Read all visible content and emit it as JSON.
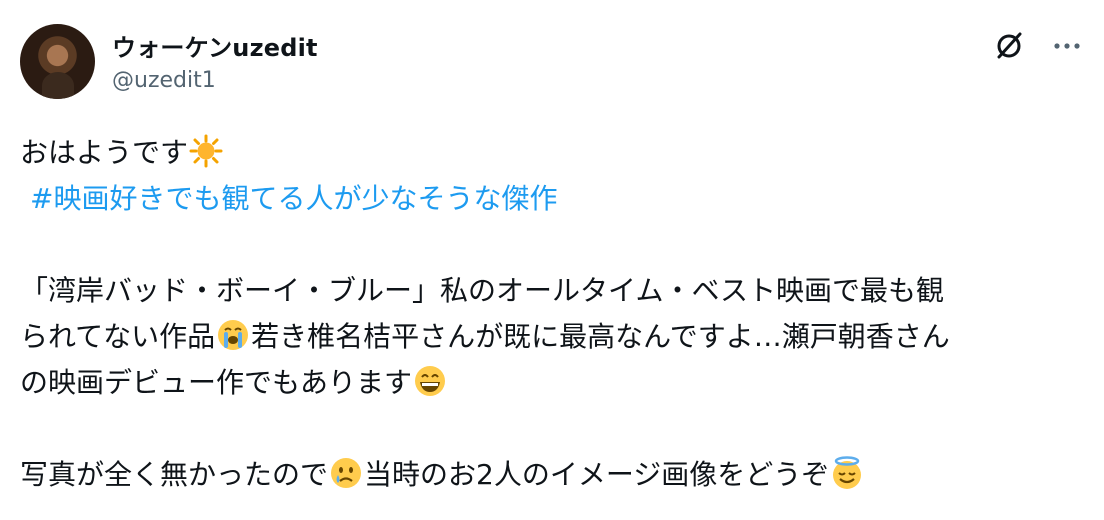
{
  "user": {
    "display_name": "ウォーケンuzedit",
    "handle": "@uzedit1"
  },
  "icons": {
    "grok": "slash-circle-icon",
    "more": "more-horizontal-icon",
    "sun": "sun-emoji",
    "crying": "loudly-crying-face-emoji",
    "grin": "grinning-face-emoji",
    "tear": "sad-tear-face-emoji",
    "halo": "smiling-face-with-halo-emoji"
  },
  "post": {
    "line1": "おはようです",
    "hashtag": "#映画好きでも観てる人が少なそうな傑作",
    "line3": "「湾岸バッド・ボーイ・ブルー」私のオールタイム・ベスト映画で最も観",
    "line4a": "られてない作品",
    "line4b": "若き椎名桔平さんが既に最高なんですよ…瀬戸朝香さん",
    "line5": "の映画デビュー作でもあります",
    "line6a": "写真が全く無かったので",
    "line6b": "当時のお2人のイメージ画像をどうぞ"
  },
  "colors": {
    "text": "#0f1419",
    "handle": "#536471",
    "link": "#1d9bf0"
  }
}
